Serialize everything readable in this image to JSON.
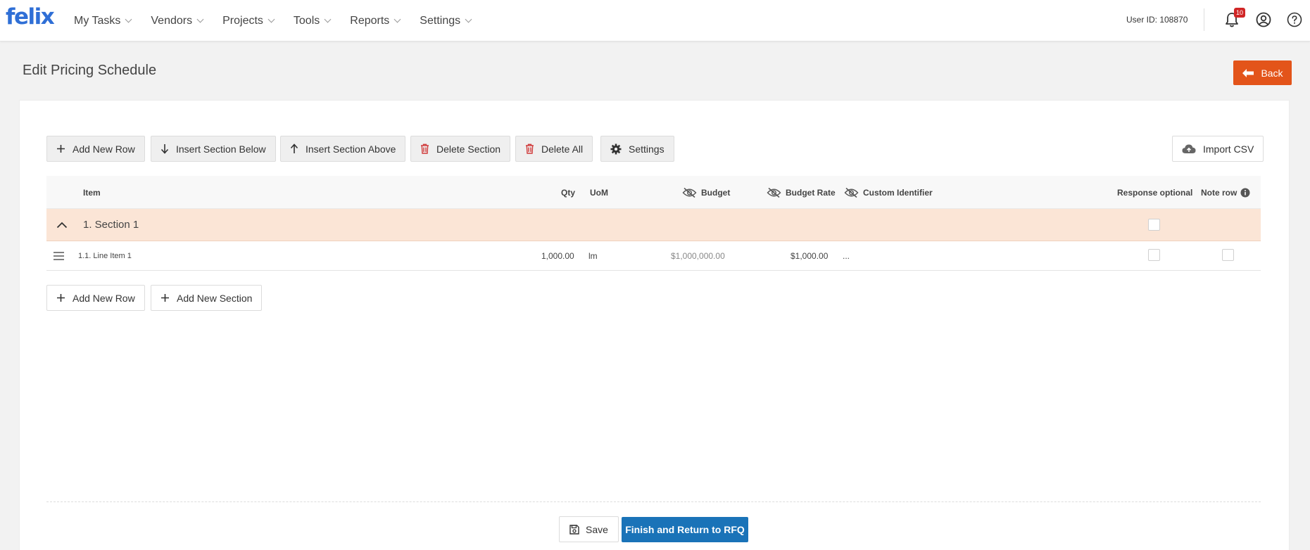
{
  "app": {
    "logo": "felix"
  },
  "nav": {
    "items": [
      {
        "label": "My Tasks"
      },
      {
        "label": "Vendors"
      },
      {
        "label": "Projects"
      },
      {
        "label": "Tools"
      },
      {
        "label": "Reports"
      },
      {
        "label": "Settings"
      }
    ],
    "user_id": "User ID: 108870",
    "notification_count": "10"
  },
  "page": {
    "title": "Edit Pricing Schedule",
    "back_label": "Back"
  },
  "toolbar": {
    "add_row": "Add New Row",
    "insert_below": "Insert Section Below",
    "insert_above": "Insert Section Above",
    "delete_section": "Delete Section",
    "delete_all": "Delete All",
    "settings": "Settings",
    "import_csv": "Import CSV"
  },
  "table": {
    "columns": {
      "item": "Item",
      "qty": "Qty",
      "uom": "UoM",
      "budget": "Budget",
      "budget_rate": "Budget Rate",
      "custom_identifier": "Custom Identifier",
      "response_optional": "Response optional",
      "note_row": "Note row"
    },
    "section": {
      "label": "1. Section 1"
    },
    "line_item": {
      "name": "1.1. Line Item 1",
      "qty": "1,000.00",
      "uom": "lm",
      "budget": "$1,000,000.00",
      "budget_rate": "$1,000.00",
      "custom_identifier": "..."
    }
  },
  "bottom": {
    "add_row": "Add New Row",
    "add_section": "Add New Section"
  },
  "footer": {
    "save": "Save",
    "finish": "Finish and Return to RFQ"
  },
  "colors": {
    "brand_blue": "#2f6fd6",
    "back_orange": "#e3541a",
    "finish_blue": "#1a73b8",
    "section_bg": "#fbe5d6",
    "delete_red": "#d03a3a",
    "badge_red": "#d02626"
  }
}
